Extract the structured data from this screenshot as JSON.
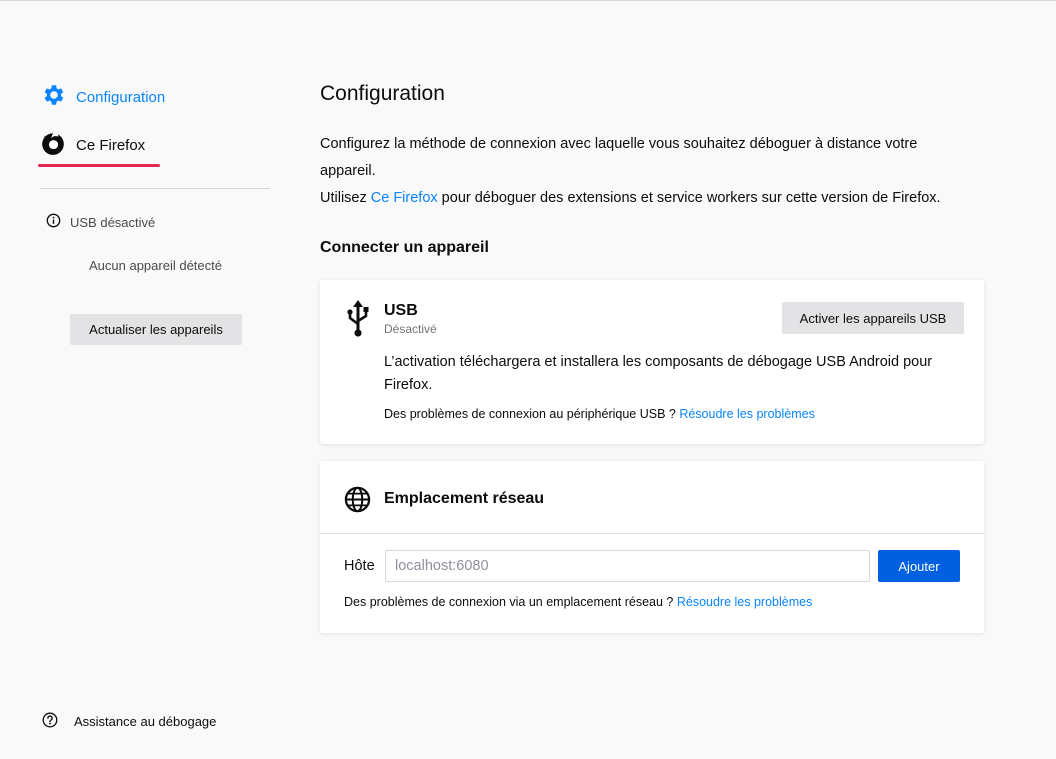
{
  "sidebar": {
    "config_label": "Configuration",
    "this_firefox_label": "Ce Firefox",
    "usb_status": "USB désactivé",
    "no_device": "Aucun appareil détecté",
    "refresh_button": "Actualiser les appareils",
    "help_label": "Assistance au débogage"
  },
  "main": {
    "title": "Configuration",
    "intro_line1": "Configurez la méthode de connexion avec laquelle vous souhaitez déboguer à distance votre appareil.",
    "intro_line2_before": "Utilisez ",
    "intro_line2_link": "Ce Firefox",
    "intro_line2_after": " pour déboguer des extensions et service workers sur cette version de Firefox.",
    "section_title": "Connecter un appareil",
    "usb": {
      "name": "USB",
      "status": "Désactivé",
      "enable_button": "Activer les appareils USB",
      "description": "L’activation téléchargera et installera les composants de débogage USB Android pour Firefox.",
      "trouble_text": "Des problèmes de connexion au périphérique USB ? ",
      "trouble_link": "Résoudre les problèmes"
    },
    "network": {
      "name": "Emplacement réseau",
      "host_label": "Hôte",
      "host_placeholder": "localhost:6080",
      "host_value": "",
      "add_button": "Ajouter",
      "trouble_text": "Des problèmes de connexion via un emplacement réseau ? ",
      "trouble_link": "Résoudre les problèmes"
    }
  },
  "colors": {
    "accent": "#0a84ff",
    "primary_button": "#0060df",
    "selected_underline": "#e22850"
  },
  "icons": {
    "config": "gear-icon",
    "firefox": "firefox-logo-icon",
    "usb_status": "info-icon",
    "help": "help-icon",
    "usb": "usb-icon",
    "network": "globe-icon"
  }
}
